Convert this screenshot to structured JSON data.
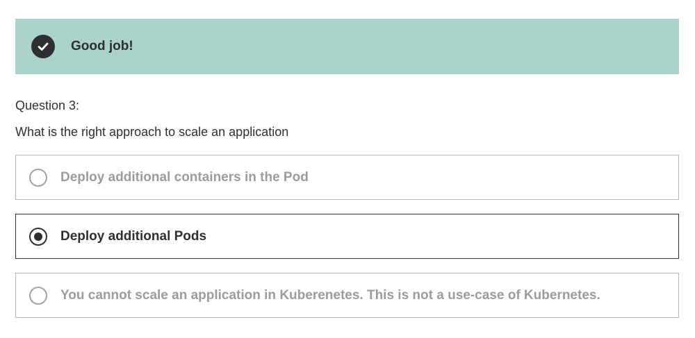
{
  "feedback": {
    "icon": "check-circle-icon",
    "message": "Good job!",
    "color": "#acd2cc"
  },
  "question": {
    "number_label": "Question 3:",
    "text": "What is the right approach to scale an application"
  },
  "options": [
    {
      "label": "Deploy additional containers in the Pod",
      "selected": false
    },
    {
      "label": "Deploy additional Pods",
      "selected": true
    },
    {
      "label": "You cannot scale an application in Kuberenetes. This is not a use-case of Kubernetes.",
      "selected": false
    }
  ]
}
